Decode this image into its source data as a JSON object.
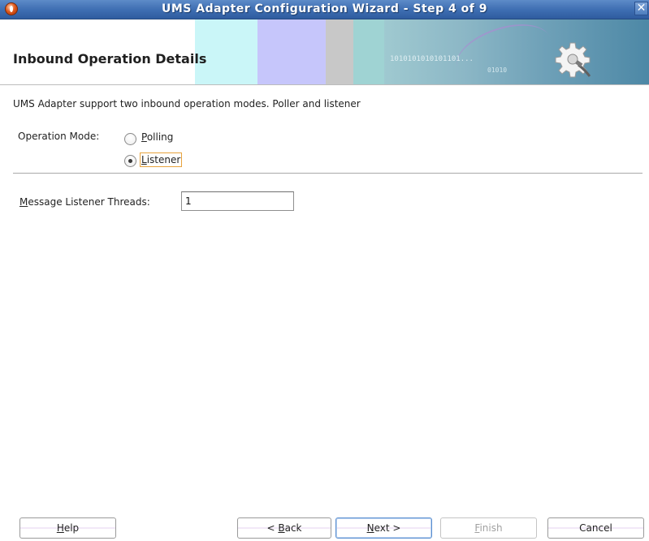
{
  "window": {
    "title": "UMS Adapter Configuration Wizard - Step 4 of 9",
    "close_glyph": "✕"
  },
  "header": {
    "title": "Inbound Operation Details",
    "binary_text": "1010101010101101...",
    "binary_text2": "01010",
    "icon": "gear-plug-icon"
  },
  "body": {
    "description": "UMS Adapter support two inbound operation modes. Poller and listener",
    "operation_mode": {
      "label": "Operation Mode:",
      "options": [
        {
          "label_mnemonic": "P",
          "label_rest": "olling",
          "checked": false
        },
        {
          "label_mnemonic": "L",
          "label_rest": "istener",
          "checked": true
        }
      ]
    },
    "threads": {
      "label_mnemonic": "M",
      "label_rest": "essage Listener Threads:",
      "value": "1"
    }
  },
  "buttons": {
    "help": {
      "mnemonic": "H",
      "rest": "elp"
    },
    "back": {
      "prefix": "< ",
      "mnemonic": "B",
      "rest": "ack"
    },
    "next": {
      "mnemonic": "N",
      "rest": "ext >"
    },
    "finish": {
      "mnemonic": "F",
      "rest": "inish",
      "enabled": false
    },
    "cancel": {
      "label": "Cancel"
    }
  },
  "colors": {
    "titlebar": "#3f6fb3",
    "focus_outline": "#e8a33d",
    "default_button_border": "#5b8fd0"
  }
}
